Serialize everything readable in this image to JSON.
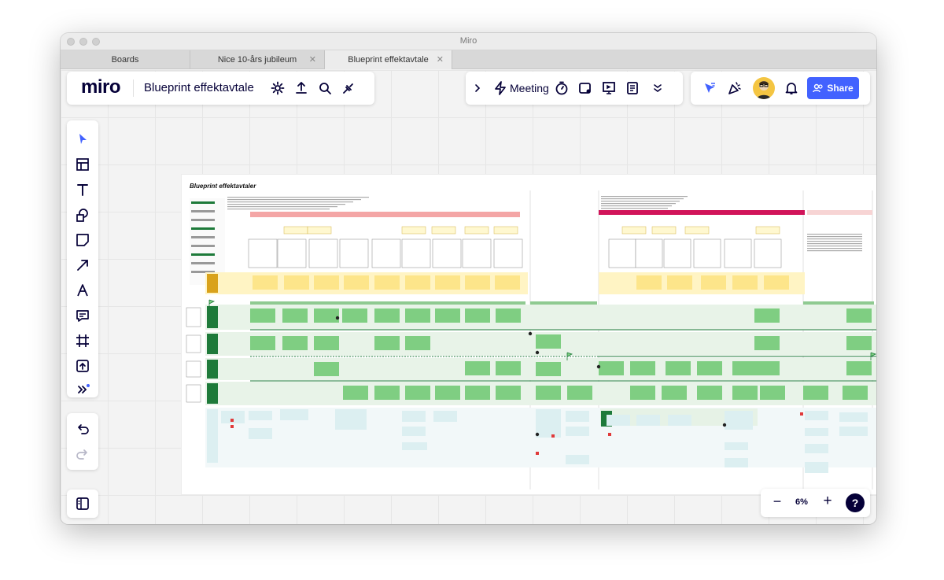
{
  "window": {
    "title": "Miro"
  },
  "browser_tabs": [
    {
      "label": "Boards",
      "closable": false,
      "active": false
    },
    {
      "label": "Nice 10-års jubileum",
      "closable": true,
      "active": false
    },
    {
      "label": "Blueprint effektavtale",
      "closable": true,
      "active": true
    }
  ],
  "topbar": {
    "logo": "miro",
    "board_title": "Blueprint effektavtale",
    "icons": [
      "settings-icon",
      "export-icon",
      "search-icon",
      "plugin-icon"
    ]
  },
  "collab": {
    "meeting_label": "Meeting",
    "icons": [
      "chevron-right-icon",
      "lightning-icon",
      "timer-icon",
      "video-icon",
      "present-icon",
      "notes-icon",
      "more-chevrons-icon"
    ]
  },
  "share": {
    "label": "Share",
    "icons": [
      "cursor-filter-icon",
      "celebrate-icon",
      "avatar",
      "bell-icon"
    ]
  },
  "left_toolbar": {
    "tools": [
      "select-tool",
      "templates-tool",
      "text-tool",
      "shapes-tool",
      "sticky-note-tool",
      "arrow-tool",
      "pen-tool",
      "comment-tool",
      "frame-tool",
      "upload-tool",
      "more-tools"
    ],
    "history": [
      "undo",
      "redo"
    ]
  },
  "zoom": {
    "level": "6%",
    "minus": "−",
    "plus": "+",
    "help": "?"
  },
  "board": {
    "heading": "Blueprint effektavtaler",
    "colors": {
      "band_green": "#e8f3e8",
      "sticky_green": "#7fce82",
      "dark_green": "#1e7a3a",
      "sticky_yellow": "#fde58a",
      "light_blue": "#dceff1",
      "pink": "#f4a6a6",
      "magenta": "#d1145a"
    }
  }
}
